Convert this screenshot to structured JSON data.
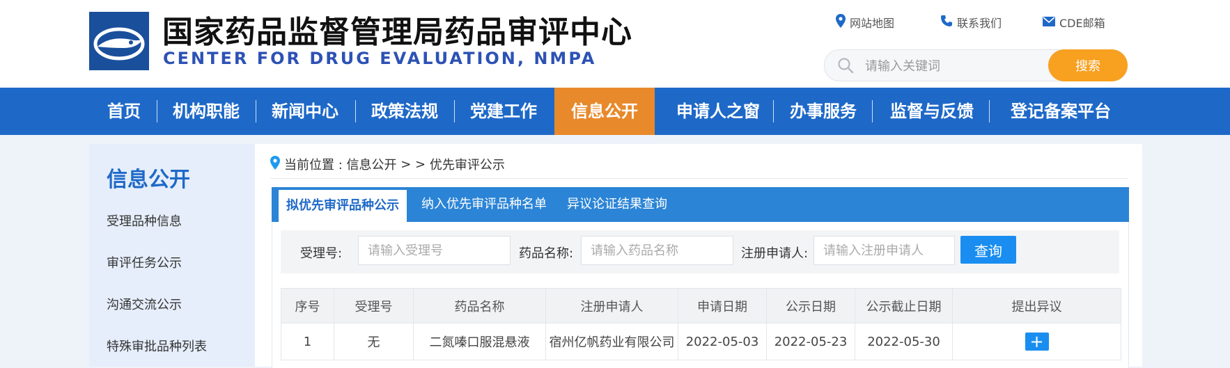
{
  "header": {
    "title_cn": "国家药品监督管理局药品审评中心",
    "title_en": "CENTER FOR DRUG EVALUATION, NMPA",
    "links": [
      {
        "label": "网站地图",
        "icon": "map-pin-icon"
      },
      {
        "label": "联系我们",
        "icon": "phone-icon"
      },
      {
        "label": "CDE邮箱",
        "icon": "mail-icon"
      }
    ],
    "search": {
      "placeholder": "请输入关键词",
      "button": "搜索"
    }
  },
  "nav": {
    "items": [
      "首页",
      "机构职能",
      "新闻中心",
      "政策法规",
      "党建工作",
      "信息公开",
      "申请人之窗",
      "办事服务",
      "监督与反馈",
      "登记备案平台"
    ],
    "active": "信息公开"
  },
  "sidebar": {
    "title": "信息公开",
    "items": [
      "受理品种信息",
      "审评任务公示",
      "沟通交流公示",
      "特殊审批品种列表"
    ]
  },
  "breadcrumb": {
    "prefix": "当前位置 : ",
    "section": "信息公开",
    "sep": " > > ",
    "current": "优先审评公示"
  },
  "tabs": [
    {
      "label": "拟优先审评品种公示",
      "active": true
    },
    {
      "label": "纳入优先审评品种名单",
      "active": false
    },
    {
      "label": "异议论证结果查询",
      "active": false
    }
  ],
  "filters": {
    "accept_no_label": "受理号:",
    "accept_no_placeholder": "请输入受理号",
    "drug_name_label": "药品名称:",
    "drug_name_placeholder": "请输入药品名称",
    "applicant_label": "注册申请人:",
    "applicant_placeholder": "请输入注册申请人",
    "query_button": "查询"
  },
  "table": {
    "columns": [
      "序号",
      "受理号",
      "药品名称",
      "注册申请人",
      "申请日期",
      "公示日期",
      "公示截止日期",
      "提出异议"
    ],
    "rows": [
      {
        "seq": "1",
        "accept_no": "无",
        "drug_name": "二氮嗪口服混悬液",
        "applicant": "宿州亿帆药业有限公司",
        "apply_date": "2022-05-03",
        "publish_date": "2022-05-23",
        "deadline": "2022-05-30",
        "action": "+"
      }
    ]
  },
  "colors": {
    "nav_bg": "#1e69c8",
    "nav_active": "#e8892b",
    "search_button": "#f8a01f",
    "tab_bar": "#2b84d6",
    "button_blue": "#1a8ef0",
    "title_en": "#2d52b5"
  }
}
